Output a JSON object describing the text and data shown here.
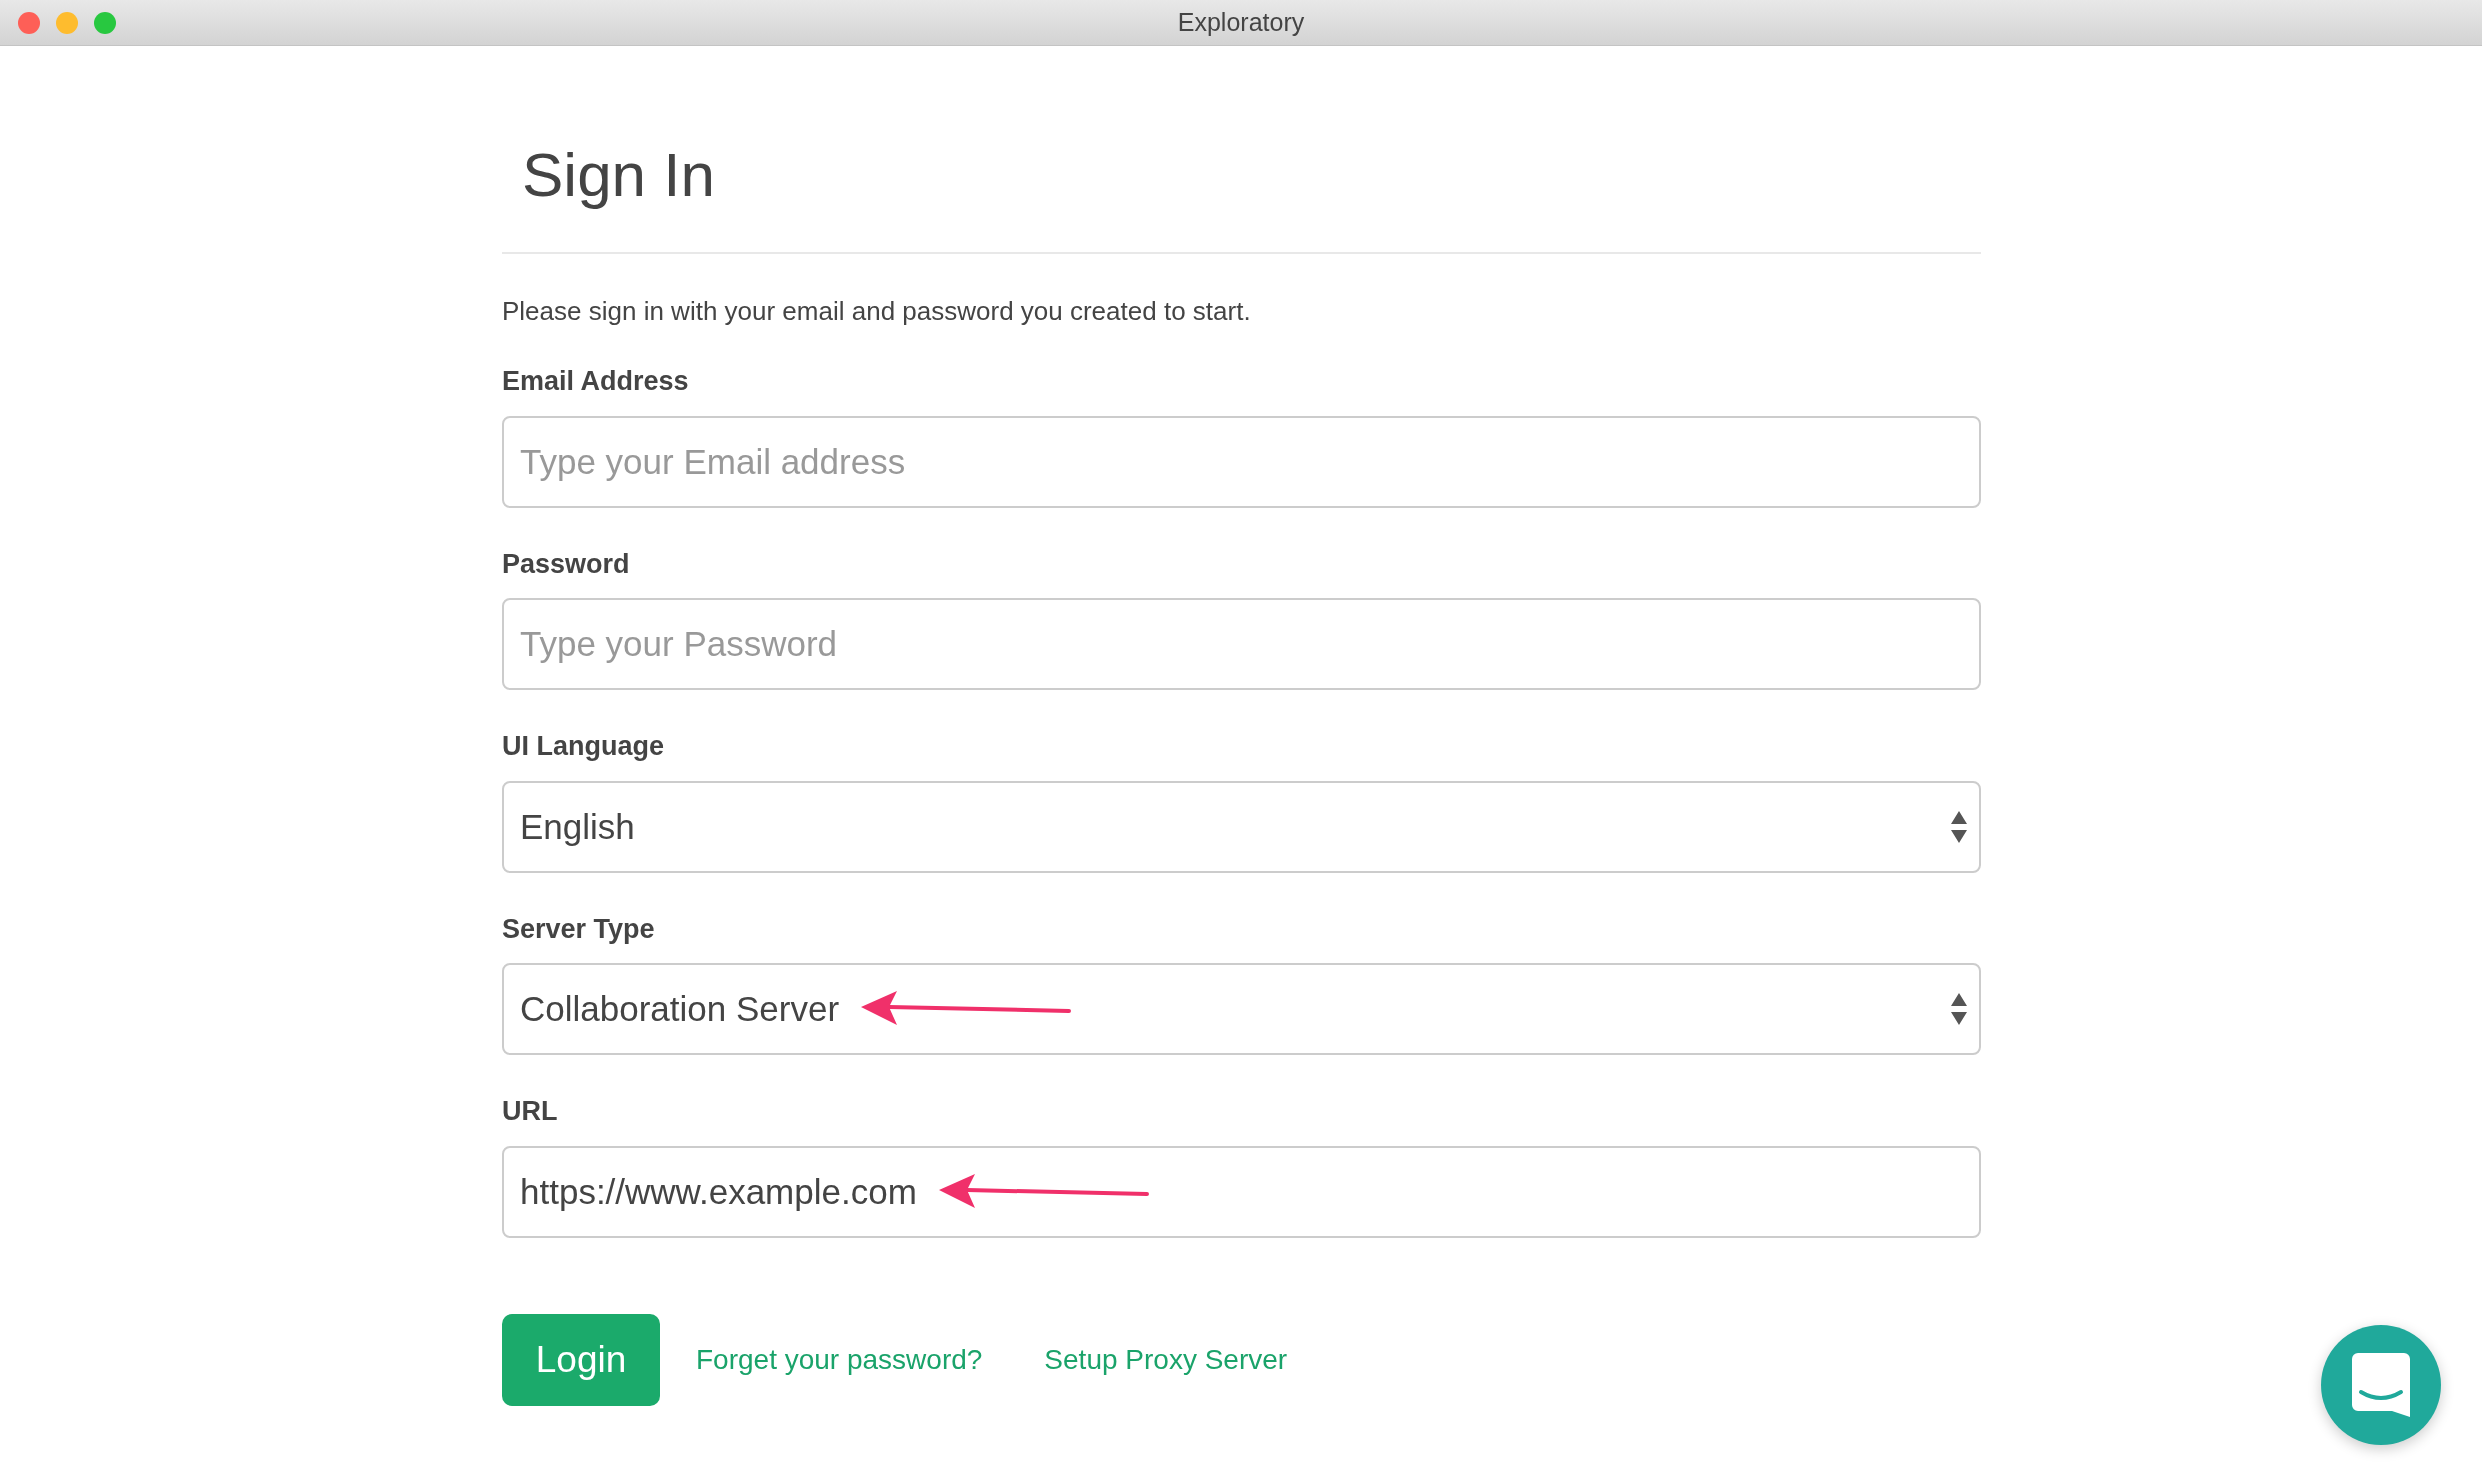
{
  "window": {
    "title": "Exploratory"
  },
  "heading": "Sign In",
  "intro": "Please sign in with your email and password you created to start.",
  "fields": [
    {
      "label": "Email Address",
      "kind": "text",
      "placeholder": "Type your Email address",
      "arrow": false
    },
    {
      "label": "Password",
      "kind": "password",
      "placeholder": "Type your Password",
      "arrow": false
    },
    {
      "label": "UI Language",
      "kind": "select",
      "value": "English",
      "arrow": false
    },
    {
      "label": "Server Type",
      "kind": "select",
      "value": "Collaboration Server",
      "arrow": true
    },
    {
      "label": "URL",
      "kind": "text",
      "value": "https://www.example.com",
      "arrow": true
    }
  ],
  "login_button": "Login",
  "links": [
    "Forget your password?",
    "Setup Proxy Server"
  ]
}
